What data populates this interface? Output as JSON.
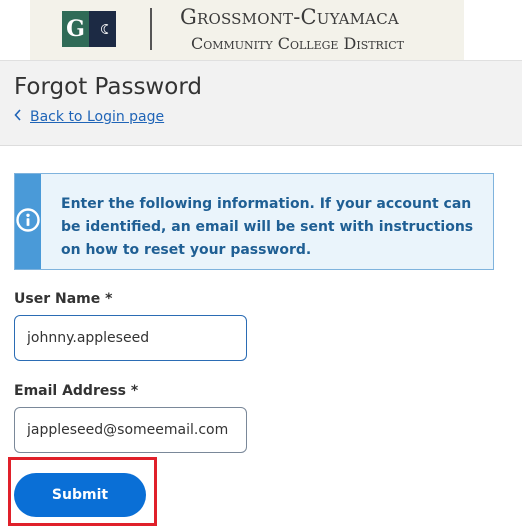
{
  "header": {
    "logo_letter": "G",
    "district_name_line1": "Grossmont-Cuyamaca",
    "district_name_line2": "Community College District"
  },
  "page": {
    "title": "Forgot Password",
    "back_link_label": "Back to Login page"
  },
  "alert": {
    "icon": "info-icon",
    "message": "Enter the following information. If your account can be identified, an email will be sent with instructions on how to reset your password."
  },
  "form": {
    "username_label": "User Name *",
    "username_value": "johnny.appleseed",
    "email_label": "Email Address *",
    "email_value": "jappleseed@someemail.com",
    "submit_label": "Submit"
  },
  "colors": {
    "accent": "#0a6fd6",
    "link": "#1f64b7",
    "alert_icon_bg": "#4a9ad8",
    "alert_bg": "#eaf4fb",
    "highlight": "#e0202a"
  }
}
